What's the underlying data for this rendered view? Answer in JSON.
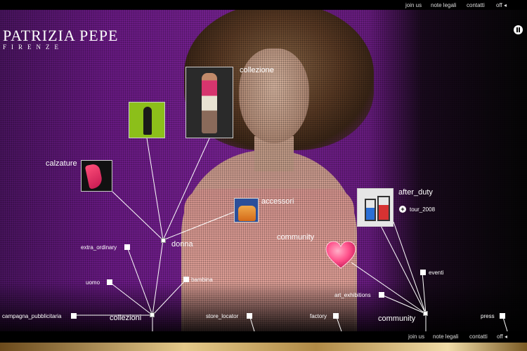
{
  "top_nav": [
    {
      "label": "join us"
    },
    {
      "label": "note legali"
    },
    {
      "label": "contatti"
    },
    {
      "label": "off ◂"
    }
  ],
  "bottom_nav": [
    {
      "label": "join us"
    },
    {
      "label": "note legali"
    },
    {
      "label": "contatti"
    },
    {
      "label": "off ◂"
    }
  ],
  "logo": {
    "name": "PATRIZIA PEPE",
    "sub": "FIRENZE"
  },
  "controls": {
    "pause_icon": "pause-icon"
  },
  "menu": {
    "collezione": "collezione",
    "calzature": "calzature",
    "accessori": "accessori",
    "after_duty": "after_duty",
    "tour_2008": "tour_2008",
    "community_center": "community",
    "donna": "donna",
    "extra_ordinary": "extra_ordinary",
    "uomo": "uomo",
    "bambina": "bambina",
    "campagna_pubblicitaria": "campagna_pubblicitaria",
    "collezioni": "collezioni",
    "store_locator": "store_locator",
    "factory": "factory",
    "community": "community",
    "eventi": "eventi",
    "art_exhibitions": "art_exhibitions",
    "press": "press"
  },
  "colors": {
    "accent": "#7a2396",
    "heart": "#ff4f8a",
    "gold": "#e4c98a"
  }
}
